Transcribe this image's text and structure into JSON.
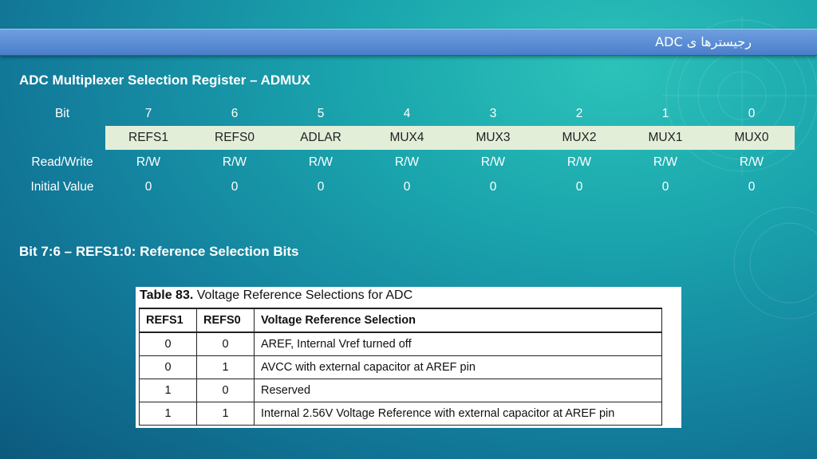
{
  "slide": {
    "title": "رجیسترها ی ADC",
    "heading1": "ADC Multiplexer Selection Register – ADMUX",
    "heading2": "Bit 7:6 – REFS1:0: Reference Selection Bits"
  },
  "register": {
    "bit_label": "Bit",
    "bits": [
      "7",
      "6",
      "5",
      "4",
      "3",
      "2",
      "1",
      "0"
    ],
    "fields": [
      "REFS1",
      "REFS0",
      "ADLAR",
      "MUX4",
      "MUX3",
      "MUX2",
      "MUX1",
      "MUX0"
    ],
    "rw_label": "Read/Write",
    "rw": [
      "R/W",
      "R/W",
      "R/W",
      "R/W",
      "R/W",
      "R/W",
      "R/W",
      "R/W"
    ],
    "init_label": "Initial Value",
    "init": [
      "0",
      "0",
      "0",
      "0",
      "0",
      "0",
      "0",
      "0"
    ]
  },
  "table83": {
    "caption_num": "Table 83.",
    "caption_text": "Voltage Reference Selections for ADC",
    "headers": [
      "REFS1",
      "REFS0",
      "Voltage Reference Selection"
    ],
    "rows": [
      [
        "0",
        "0",
        "AREF, Internal Vref turned off"
      ],
      [
        "0",
        "1",
        "AVCC with external capacitor at AREF pin"
      ],
      [
        "1",
        "0",
        "Reserved"
      ],
      [
        "1",
        "1",
        "Internal 2.56V Voltage Reference with external capacitor at AREF pin"
      ]
    ]
  }
}
